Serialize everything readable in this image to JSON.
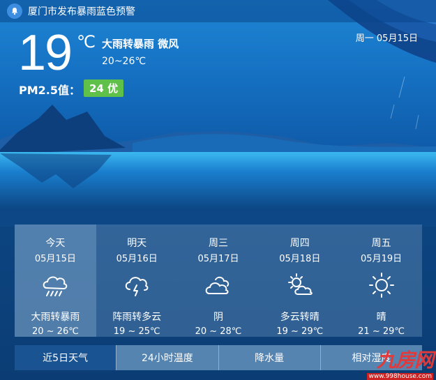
{
  "alert": {
    "text": "厦门市发布暴雨蓝色预警",
    "icon": "bell-icon"
  },
  "current": {
    "temperature": "19",
    "unit": "℃",
    "condition": "大雨转暴雨 微风",
    "range": "20~26℃",
    "date": "周一 05月15日",
    "pm_label": "PM2.5值：",
    "pm_value": "24 优",
    "pm_color": "#5fc04a"
  },
  "forecast": [
    {
      "name": "今天",
      "date": "05月15日",
      "icon": "heavy-rain-icon",
      "condition": "大雨转暴雨",
      "range": "20 ~ 26℃"
    },
    {
      "name": "明天",
      "date": "05月16日",
      "icon": "thunder-shower-icon",
      "condition": "阵雨转多云",
      "range": "19 ~ 25℃"
    },
    {
      "name": "周三",
      "date": "05月17日",
      "icon": "overcast-icon",
      "condition": "阴",
      "range": "20 ~ 28℃"
    },
    {
      "name": "周四",
      "date": "05月18日",
      "icon": "partly-cloudy-icon",
      "condition": "多云转晴",
      "range": "19 ~ 29℃"
    },
    {
      "name": "周五",
      "date": "05月19日",
      "icon": "sunny-icon",
      "condition": "晴",
      "range": "21 ~ 29℃"
    }
  ],
  "tabs": [
    "近5日天气",
    "24小时温度",
    "降水量",
    "相对湿度"
  ],
  "watermark": {
    "main": "九房网",
    "sub": "www.998house.com"
  }
}
